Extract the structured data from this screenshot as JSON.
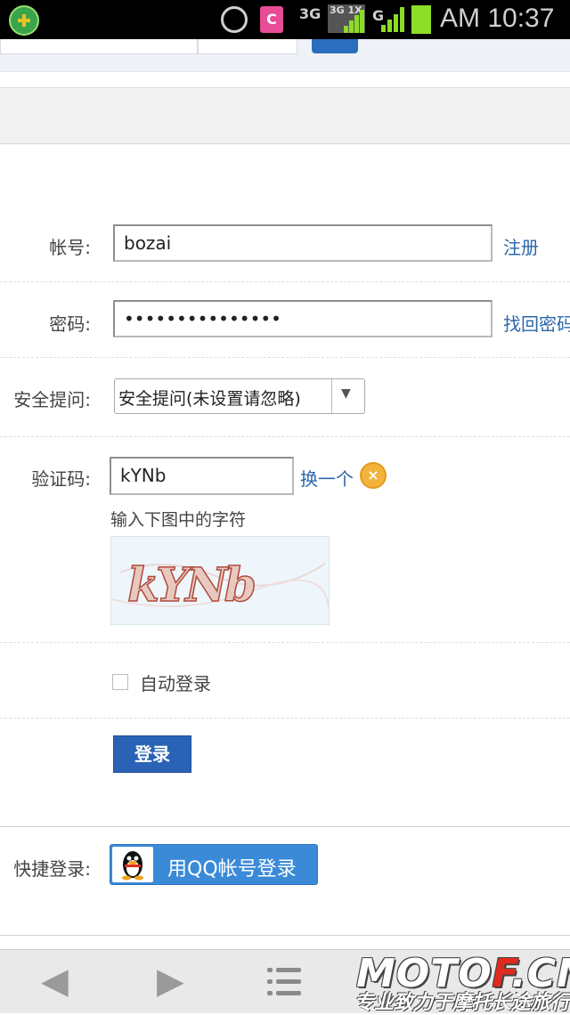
{
  "status_bar": {
    "calendar_label": "C",
    "net_3g": "3G",
    "net_3g1x": "3G 1X",
    "net_g": "G",
    "time": "AM 10:37",
    "colors": {
      "signal": "#8ddc27",
      "bg": "#000000"
    }
  },
  "form": {
    "account_label": "帐号:",
    "account_value": "bozai",
    "register_link": "注册",
    "password_label": "密码:",
    "password_value": "•••••••••••••••",
    "recover_link": "找回密码",
    "question_label": "安全提问:",
    "question_selected": "安全提问(未设置请忽略)",
    "question_arrow": "▼",
    "captcha_label": "验证码:",
    "captcha_value": "kYNb",
    "refresh_link": "换一个",
    "refresh_icon_glyph": "×",
    "captcha_hint": "输入下图中的字符",
    "captcha_image_text": "kYNb",
    "remember_label": "自动登录",
    "login_button": "登录",
    "quick_label": "快捷登录:",
    "qq_button": "用QQ帐号登录"
  },
  "colors": {
    "link": "#2b67a9",
    "primary_button": "#2a63b6",
    "qq_button": "#3a8ad8"
  },
  "bottom_nav": {
    "back_icon": "◀",
    "forward_icon": "▶"
  },
  "watermark": {
    "logo_main": "MOTO",
    "logo_accent": "F",
    "logo_suffix": ".CN",
    "slogan": "专业致力于摩托长途旅行"
  }
}
